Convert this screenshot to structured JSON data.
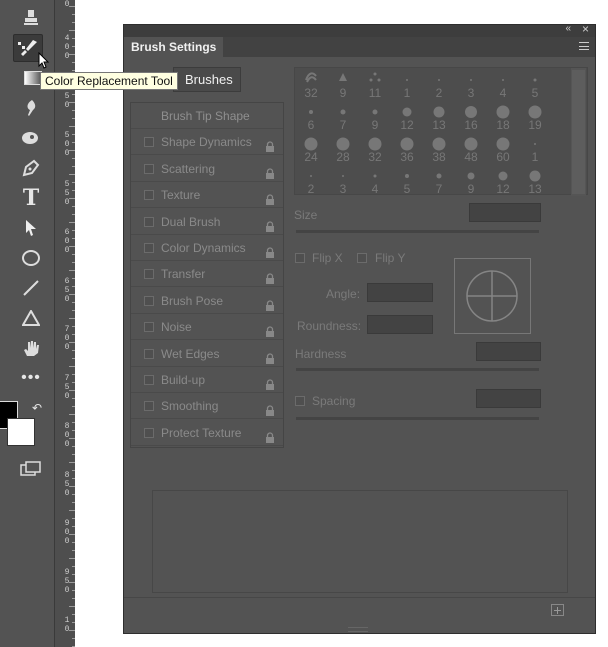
{
  "tooltip": {
    "text": "Color Replacement Tool"
  },
  "ruler": {
    "labels": [
      "0",
      "4\n0\n0",
      "4\n5\n0",
      "5\n0\n0",
      "5\n5\n0",
      "6\n0\n0",
      "6\n5\n0",
      "7\n0\n0",
      "7\n5\n0",
      "8\n0\n0",
      "8\n5\n0",
      "9\n0\n0",
      "9\n5\n0",
      "1\n0"
    ]
  },
  "panel": {
    "title": "Brush Settings",
    "brushes_button": "Brushes",
    "options": [
      {
        "label": "Brush Tip Shape",
        "header": true
      },
      {
        "label": "Shape Dynamics"
      },
      {
        "label": "Scattering"
      },
      {
        "label": "Texture"
      },
      {
        "label": "Dual Brush"
      },
      {
        "label": "Color Dynamics"
      },
      {
        "label": "Transfer"
      },
      {
        "label": "Brush Pose"
      },
      {
        "label": "Noise"
      },
      {
        "label": "Wet Edges"
      },
      {
        "label": "Build-up"
      },
      {
        "label": "Smoothing"
      },
      {
        "label": "Protect Texture"
      }
    ],
    "brush_sizes": [
      [
        "32",
        "9",
        "11",
        "1",
        "2",
        "3",
        "4",
        "5"
      ],
      [
        "6",
        "7",
        "9",
        "12",
        "13",
        "16",
        "18",
        "19"
      ],
      [
        "24",
        "28",
        "32",
        "36",
        "38",
        "48",
        "60",
        "1"
      ],
      [
        "2",
        "3",
        "4",
        "5",
        "7",
        "9",
        "12",
        "13"
      ]
    ],
    "size_label": "Size",
    "flip_x": "Flip X",
    "flip_y": "Flip Y",
    "angle_label": "Angle:",
    "roundness_label": "Roundness:",
    "hardness_label": "Hardness",
    "spacing_label": "Spacing"
  },
  "colors": {
    "panel_bg": "#535353",
    "toolbar_bg": "#535353",
    "foreground": "#000000",
    "background": "#ffffff"
  }
}
